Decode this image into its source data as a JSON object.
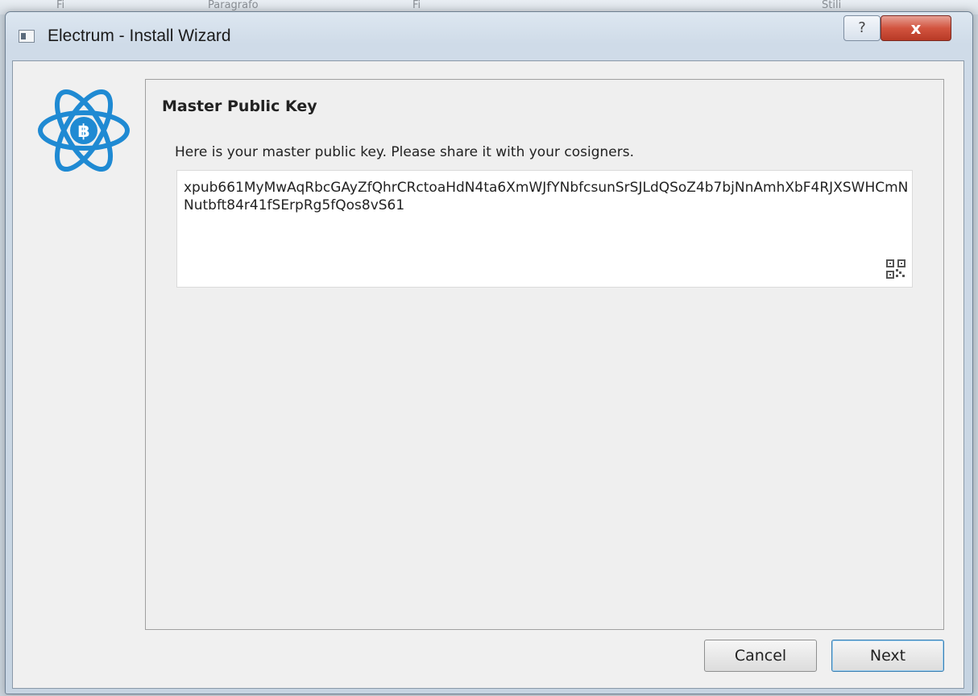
{
  "window": {
    "title": "Electrum  -  Install Wizard",
    "help_label": "?",
    "close_label": "x"
  },
  "background_app": {
    "labels": [
      "Fi",
      "Paragrafo",
      "Fi",
      "Stili"
    ]
  },
  "icons": {
    "app": "electrum-window-icon",
    "logo": "electrum-bitcoin-atom-logo",
    "qr": "qr-code-icon"
  },
  "page": {
    "heading": "Master Public Key",
    "message": "Here is your master public key. Please share it with your cosigners.",
    "key_value": "xpub661MyMwAqRbcGAyZfQhrCRctoaHdN4ta6XmWJfYNbfcsunSrSJLdQSoZ4b7bjNnAmhXbF4RJXSWHCmNNutbft84r41fSErpRg5fQos8vS61"
  },
  "buttons": {
    "cancel": "Cancel",
    "next": "Next"
  },
  "colors": {
    "logo_blue": "#1f8ad3",
    "close_red": "#c94532"
  }
}
